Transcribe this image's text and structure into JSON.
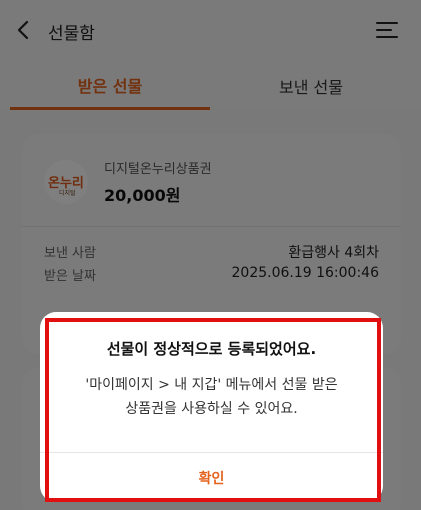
{
  "header": {
    "title": "선물함",
    "back_icon": "chevron-left-icon",
    "menu_icon": "menu-icon"
  },
  "tabs": [
    {
      "label": "받은 선물",
      "active": true
    },
    {
      "label": "보낸 선물",
      "active": false
    }
  ],
  "gift_card": {
    "logo_text": "온누리",
    "logo_subtext": "디지털",
    "product_name": "디지털온누리상품권",
    "amount": "20,000원",
    "sender_label": "보낸 사람",
    "sender_value": "환급행사 4회차",
    "date_label": "받은 날짜",
    "date_value": "2025.06.19 16:00:46"
  },
  "dialog": {
    "title": "선물이 정상적으로 등록되었어요.",
    "message_line1": "'마이페이지 > 내 지갑' 메뉴에서 선물 받은",
    "message_line2": "상품권을 사용하실 수 있어요.",
    "confirm_label": "확인"
  },
  "colors": {
    "accent": "#e4631e",
    "highlight": "#e10f0f"
  }
}
